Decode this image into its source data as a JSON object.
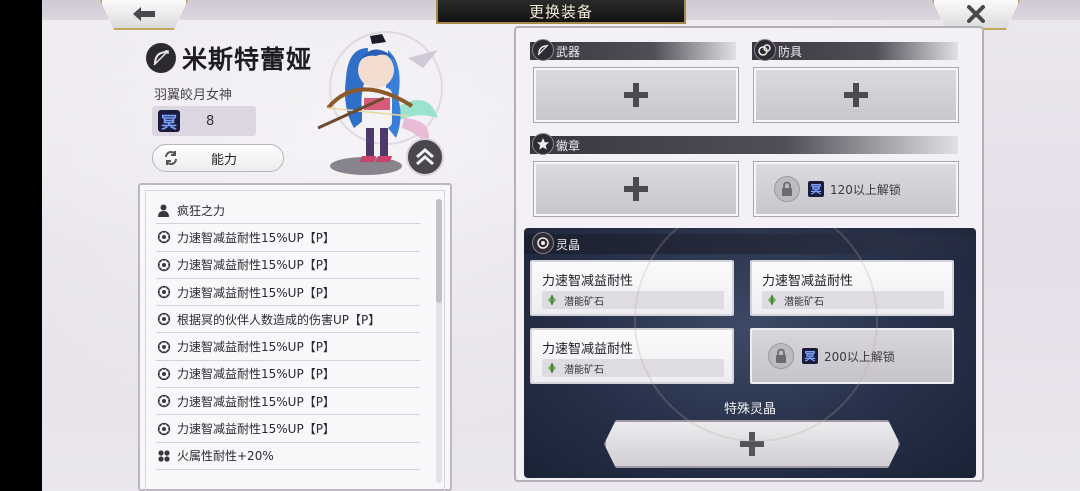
{
  "header": {
    "title": "更换装备",
    "back_icon": "arrow-left-icon",
    "close_icon": "close-icon"
  },
  "character": {
    "name": "米斯特蕾娅",
    "subtitle": "羽翼皎月女神",
    "rank_glyph": "冥",
    "level": "8",
    "ability_button": "能力"
  },
  "skills": [
    {
      "icon": "person-icon",
      "label": "疯狂之力"
    },
    {
      "icon": "gear-icon",
      "label": "力速智减益耐性15%UP【P】"
    },
    {
      "icon": "gear-icon",
      "label": "力速智减益耐性15%UP【P】"
    },
    {
      "icon": "gear-icon",
      "label": "力速智减益耐性15%UP【P】"
    },
    {
      "icon": "gear-icon",
      "label": "根据冥的伙伴人数造成的伤害UP【P】"
    },
    {
      "icon": "gear-icon",
      "label": "力速智减益耐性15%UP【P】"
    },
    {
      "icon": "gear-icon",
      "label": "力速智减益耐性15%UP【P】"
    },
    {
      "icon": "gear-icon",
      "label": "力速智减益耐性15%UP【P】"
    },
    {
      "icon": "gear-icon",
      "label": "力速智减益耐性15%UP【P】"
    },
    {
      "icon": "element-icon",
      "label": "火属性耐性+20%"
    }
  ],
  "equipment": {
    "weapon_label": "武器",
    "armor_label": "防具",
    "badge_label": "徽章",
    "badge_lock_text": "120以上解锁",
    "rank_glyph": "冥"
  },
  "crystals": {
    "section_label": "灵晶",
    "slots": [
      {
        "name": "力速智减益耐性",
        "sub": "潜能矿石"
      },
      {
        "name": "力速智减益耐性",
        "sub": "潜能矿石"
      },
      {
        "name": "力速智减益耐性",
        "sub": "潜能矿石"
      }
    ],
    "lock_text": "200以上解锁",
    "special_label": "特殊灵晶"
  }
}
